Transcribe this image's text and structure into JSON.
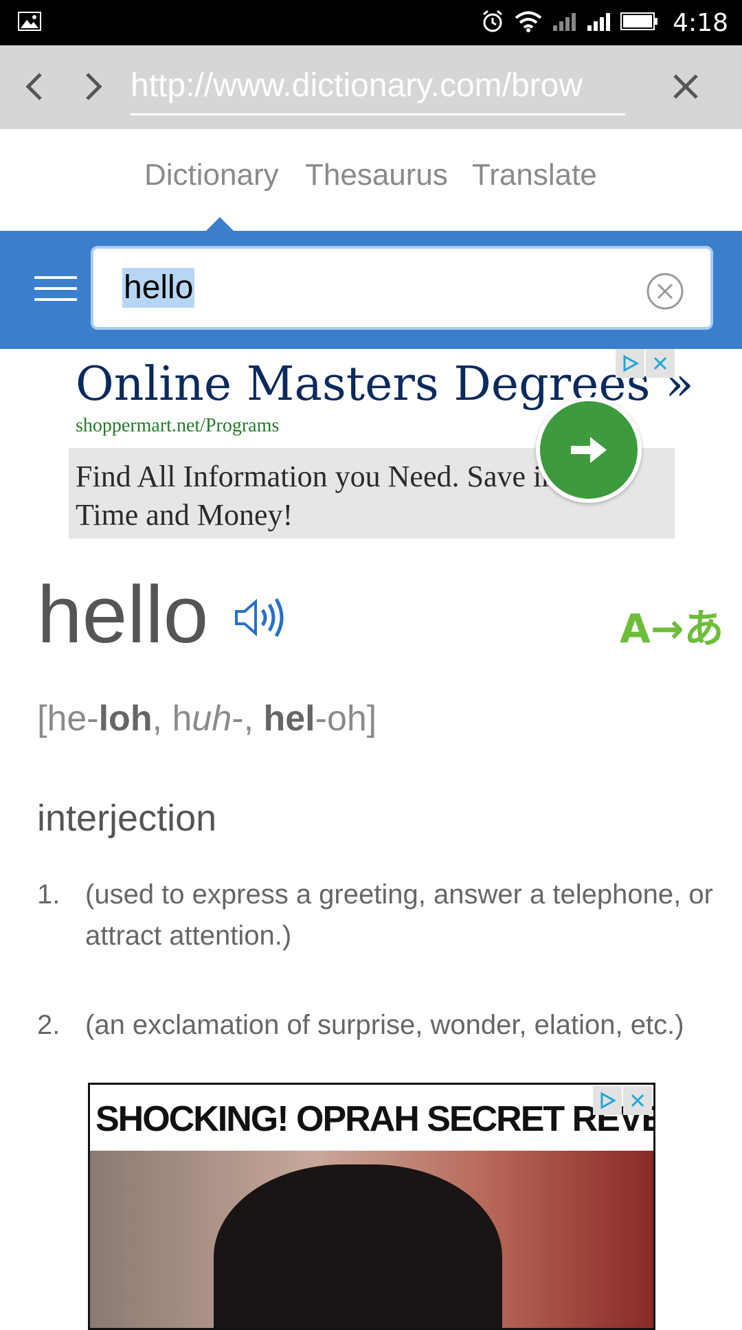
{
  "status_bar": {
    "time": "4:18"
  },
  "browser": {
    "url": "http://www.dictionary.com/brow"
  },
  "site_tabs": [
    {
      "label": "Dictionary"
    },
    {
      "label": "Thesaurus"
    },
    {
      "label": "Translate"
    }
  ],
  "search": {
    "value": "hello"
  },
  "ad_top": {
    "title": "Online Masters Degrees »",
    "url": "shoppermart.net/Programs",
    "body": "Find All Information you Need. Save in Your Time and Money!"
  },
  "entry": {
    "word": "hello",
    "pronunciation_parts": [
      "[he-",
      "loh",
      ", h",
      "uh",
      "-, ",
      "hel",
      "-oh]"
    ],
    "part_of_speech": "interjection",
    "definitions": [
      {
        "num": "1.",
        "text": "(used to express a greeting, answer a telephone, or attract attention.)"
      },
      {
        "num": "2.",
        "text": "(an exclamation of surprise, wonder, elation, etc.)"
      }
    ]
  },
  "ad_bottom": {
    "headline": "SHOCKING! OPRAH SECRET REVEALED!"
  },
  "colors": {
    "brand_blue": "#3b7fcc",
    "ad_green": "#3d9a3d",
    "translate_green": "#6dbd3b"
  }
}
